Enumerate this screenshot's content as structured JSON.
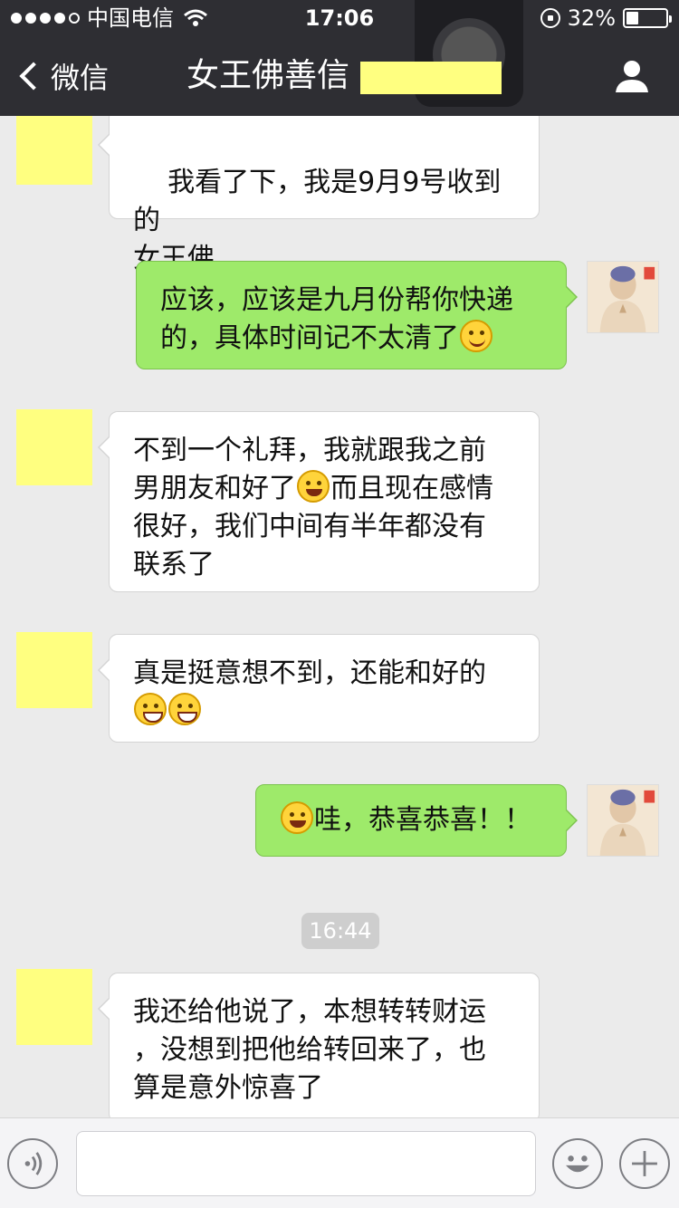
{
  "status_bar": {
    "carrier": "中国电信",
    "time": "17:06",
    "battery_text": "32%",
    "battery_level": 0.32
  },
  "nav": {
    "back_label": "微信",
    "title": "女王佛善信"
  },
  "colors": {
    "header_bg": "#2e2e33",
    "chat_bg": "#ebebeb",
    "bubble_in": "#ffffff",
    "bubble_out": "#9eea6a",
    "redaction": "#ffff80"
  },
  "messages": [
    {
      "direction": "in",
      "text": "我看了下，我是9月9号收到的\n女王佛"
    },
    {
      "direction": "out",
      "text_before": "应该，应该是九月份帮你快递\n的，具体时间记不太清了",
      "emoji": "smile-emoji"
    },
    {
      "direction": "in",
      "text_a": "不到一个礼拜，我就跟我之前\n男朋友和好了",
      "emoji": "laugh-emoji",
      "text_b": "而且现在感情\n很好，我们中间有半年都没有\n联系了"
    },
    {
      "direction": "in",
      "text": "真是挺意想不到，还能和好的",
      "emoji": "grin-emoji"
    },
    {
      "direction": "out",
      "emoji": "giggle-emoji",
      "text": "哇，恭喜恭喜！！"
    },
    {
      "direction": "in",
      "text": "我还给他说了，本想转转财运\n，没想到把他给转回来了，也\n算是意外惊喜了"
    }
  ],
  "timestamp_divider": "16:44",
  "input": {
    "placeholder": ""
  }
}
